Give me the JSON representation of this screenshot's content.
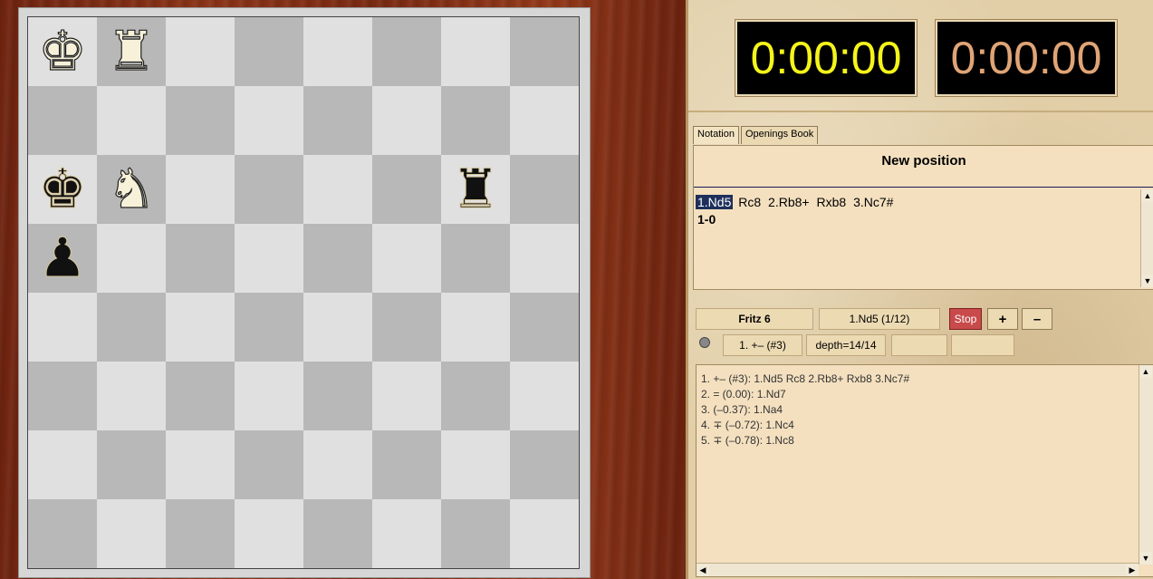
{
  "board": {
    "squares": [
      [
        "wK",
        "wR",
        "",
        "",
        "",
        "",
        "",
        ""
      ],
      [
        "",
        "",
        "",
        "",
        "",
        "",
        "",
        ""
      ],
      [
        "bK",
        "wN",
        "",
        "",
        "",
        "",
        "bR",
        ""
      ],
      [
        "bP",
        "",
        "",
        "",
        "",
        "",
        "",
        ""
      ],
      [
        "",
        "",
        "",
        "",
        "",
        "",
        "",
        ""
      ],
      [
        "",
        "",
        "",
        "",
        "",
        "",
        "",
        ""
      ],
      [
        "",
        "",
        "",
        "",
        "",
        "",
        "",
        ""
      ],
      [
        "",
        "",
        "",
        "",
        "",
        "",
        "",
        ""
      ]
    ],
    "glyphs": {
      "wK": "♚",
      "wR": "♜",
      "wN": "♞",
      "bK": "♚",
      "bR": "♜",
      "bP": "♟"
    }
  },
  "clocks": {
    "white": "0:00:00",
    "black": "0:00:00",
    "white_color": "#f5f51a",
    "black_color": "#e0a476"
  },
  "tabs": [
    "Notation",
    "Openings Book"
  ],
  "notation": {
    "title": "New position",
    "moves": [
      "1.Nd5",
      "Rc8",
      "2.Rb8+",
      "Rxb8",
      "3.Nc7#"
    ],
    "result": "1-0"
  },
  "engine": {
    "name": "Fritz 6",
    "current_move": "1.Nd5 (1/12)",
    "stop_label": "Stop",
    "plus_label": "+",
    "minus_label": "–",
    "eval": "1. +– (#3)",
    "depth": "depth=14/14"
  },
  "analysis_lines": [
    "1. +– (#3): 1.Nd5 Rc8 2.Rb8+ Rxb8 3.Nc7#",
    "2. = (0.00): 1.Nd7",
    "3.   (–0.37): 1.Na4",
    "4. ∓ (–0.72): 1.Nc4",
    "5. ∓ (–0.78): 1.Nc8"
  ]
}
